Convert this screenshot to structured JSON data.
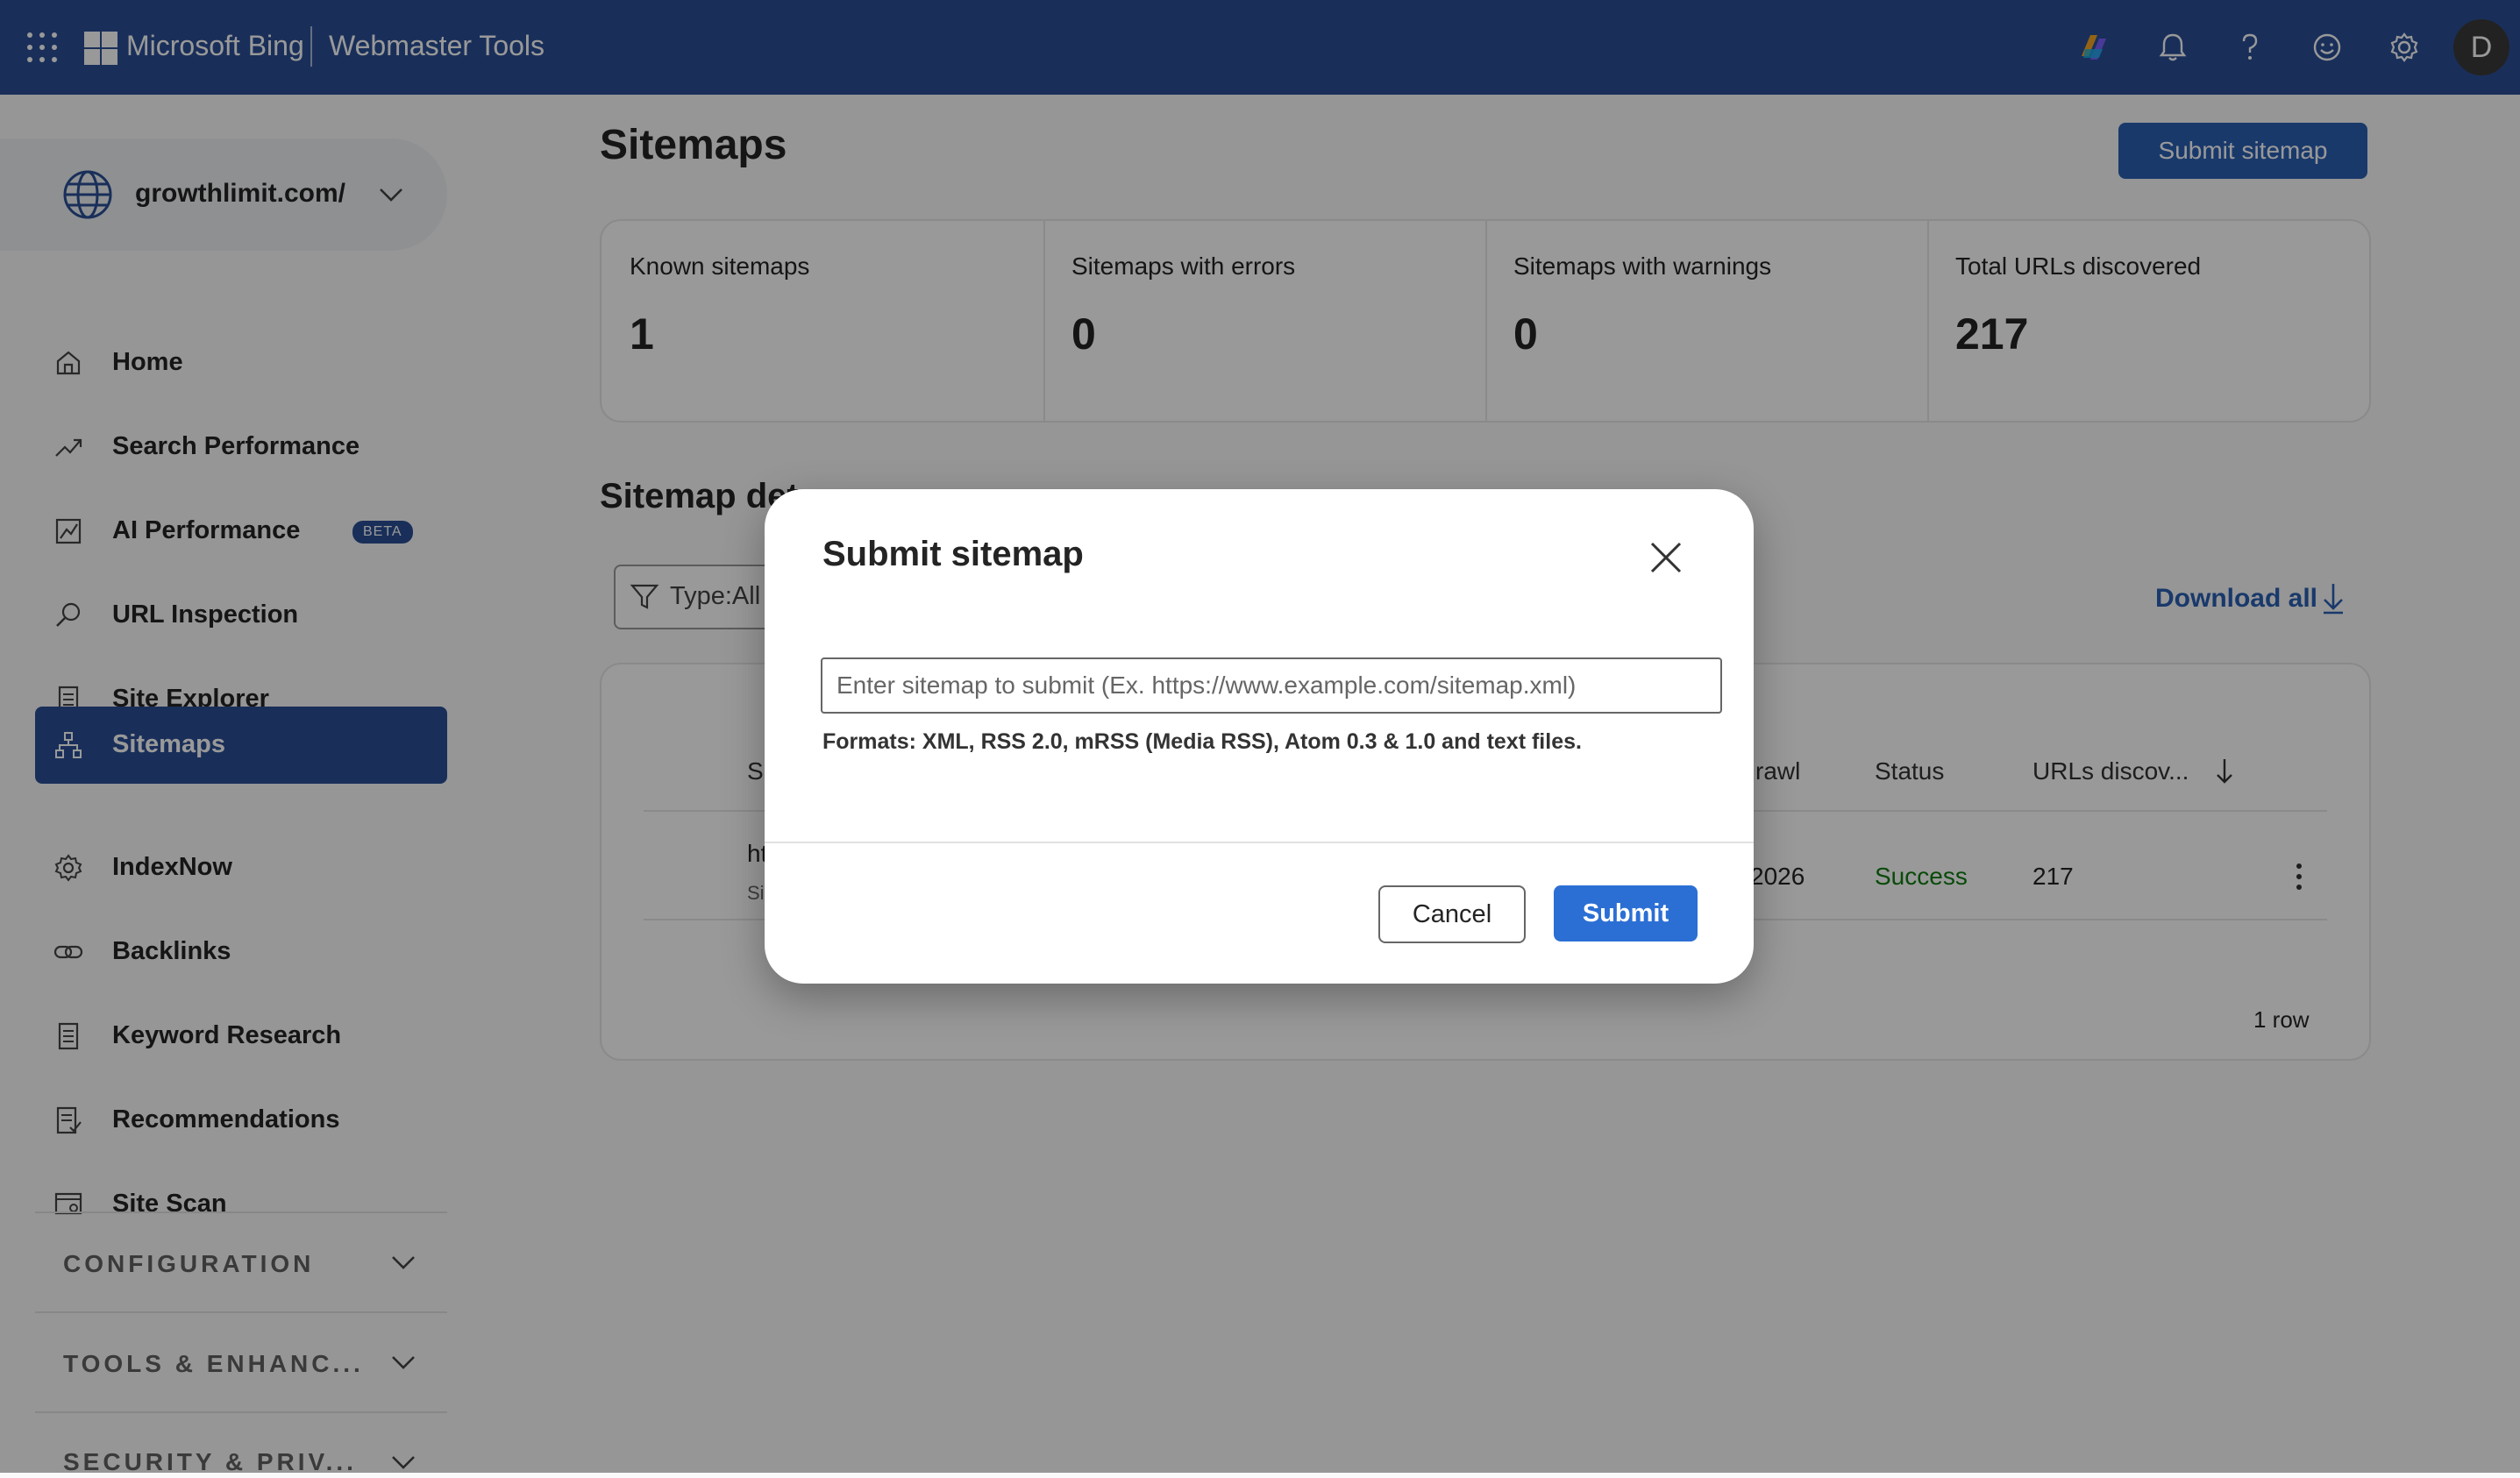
{
  "header": {
    "brand": "Microsoft Bing",
    "product": "Webmaster Tools",
    "avatar_initial": "D",
    "icons": [
      "apps-grid-icon",
      "copilot-icon",
      "bell-icon",
      "help-icon",
      "feedback-smiley-icon",
      "gear-icon"
    ]
  },
  "sidebar": {
    "site": "growthlimit.com/",
    "items": [
      {
        "label": "Home",
        "icon": "home-icon"
      },
      {
        "label": "Search Performance",
        "icon": "trending-icon"
      },
      {
        "label": "AI Performance",
        "icon": "chart-icon",
        "badge": "BETA"
      },
      {
        "label": "URL Inspection",
        "icon": "search-icon"
      },
      {
        "label": "Site Explorer",
        "icon": "document-icon"
      },
      {
        "label": "Sitemaps",
        "icon": "sitemap-icon",
        "active": true
      },
      {
        "label": "IndexNow",
        "icon": "gear-icon"
      },
      {
        "label": "Backlinks",
        "icon": "link-icon"
      },
      {
        "label": "Keyword Research",
        "icon": "document-icon"
      },
      {
        "label": "Recommendations",
        "icon": "checklist-icon"
      },
      {
        "label": "Site Scan",
        "icon": "scan-icon"
      }
    ],
    "sections": [
      "CONFIGURATION",
      "TOOLS & ENHANC...",
      "SECURITY & PRIV..."
    ]
  },
  "main": {
    "title": "Sitemaps",
    "submit_button": "Submit sitemap",
    "stats": [
      {
        "label": "Known sitemaps",
        "value": "1"
      },
      {
        "label": "Sitemaps with errors",
        "value": "0"
      },
      {
        "label": "Sitemaps with warnings",
        "value": "0"
      },
      {
        "label": "Total URLs discovered",
        "value": "217"
      }
    ],
    "details_title": "Sitemap det",
    "filter_label": "Type:All",
    "download_label": "Download all",
    "table": {
      "headers": [
        "Si",
        "rawl",
        "Status",
        "URLs discov..."
      ],
      "row": {
        "url_fragment": "ht",
        "type_fragment": "Si",
        "last_crawl_fragment": "2026",
        "status": "Success",
        "urls": "217"
      },
      "status_color": "#107c10",
      "row_count": "1 row"
    }
  },
  "dialog": {
    "title": "Submit sitemap",
    "placeholder": "Enter sitemap to submit (Ex. https://www.example.com/sitemap.xml)",
    "value": "",
    "formats_note": "Formats: XML, RSS 2.0, mRSS (Media RSS), Atom 0.3 & 1.0 and text files.",
    "cancel_label": "Cancel",
    "submit_label": "Submit"
  },
  "colors": {
    "accent": "#2b4f96",
    "primary": "#2b6fd4",
    "success": "#107c10"
  }
}
